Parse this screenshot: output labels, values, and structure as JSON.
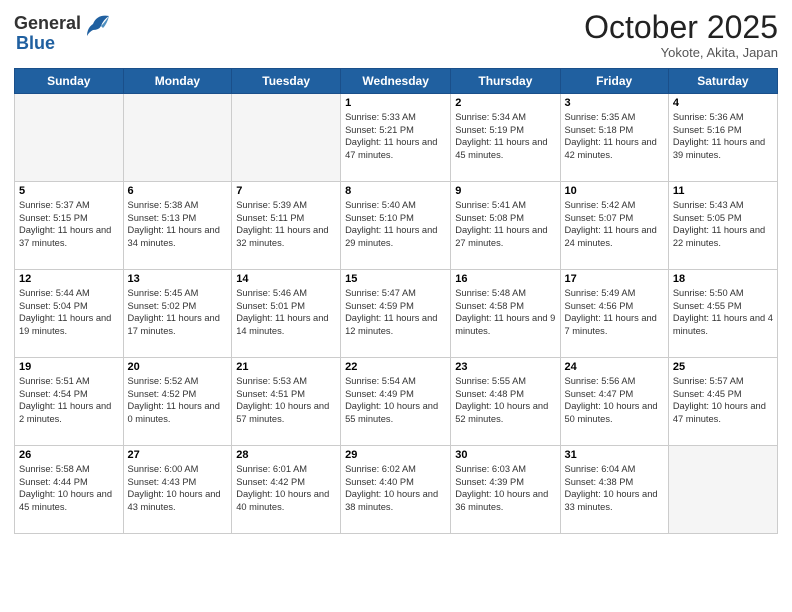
{
  "header": {
    "logo_general": "General",
    "logo_blue": "Blue",
    "month_title": "October 2025",
    "location": "Yokote, Akita, Japan"
  },
  "weekdays": [
    "Sunday",
    "Monday",
    "Tuesday",
    "Wednesday",
    "Thursday",
    "Friday",
    "Saturday"
  ],
  "weeks": [
    [
      {
        "day": "",
        "empty": true
      },
      {
        "day": "",
        "empty": true
      },
      {
        "day": "",
        "empty": true
      },
      {
        "day": "1",
        "sunrise": "5:33 AM",
        "sunset": "5:21 PM",
        "daylight": "11 hours and 47 minutes."
      },
      {
        "day": "2",
        "sunrise": "5:34 AM",
        "sunset": "5:19 PM",
        "daylight": "11 hours and 45 minutes."
      },
      {
        "day": "3",
        "sunrise": "5:35 AM",
        "sunset": "5:18 PM",
        "daylight": "11 hours and 42 minutes."
      },
      {
        "day": "4",
        "sunrise": "5:36 AM",
        "sunset": "5:16 PM",
        "daylight": "11 hours and 39 minutes."
      }
    ],
    [
      {
        "day": "5",
        "sunrise": "5:37 AM",
        "sunset": "5:15 PM",
        "daylight": "11 hours and 37 minutes."
      },
      {
        "day": "6",
        "sunrise": "5:38 AM",
        "sunset": "5:13 PM",
        "daylight": "11 hours and 34 minutes."
      },
      {
        "day": "7",
        "sunrise": "5:39 AM",
        "sunset": "5:11 PM",
        "daylight": "11 hours and 32 minutes."
      },
      {
        "day": "8",
        "sunrise": "5:40 AM",
        "sunset": "5:10 PM",
        "daylight": "11 hours and 29 minutes."
      },
      {
        "day": "9",
        "sunrise": "5:41 AM",
        "sunset": "5:08 PM",
        "daylight": "11 hours and 27 minutes."
      },
      {
        "day": "10",
        "sunrise": "5:42 AM",
        "sunset": "5:07 PM",
        "daylight": "11 hours and 24 minutes."
      },
      {
        "day": "11",
        "sunrise": "5:43 AM",
        "sunset": "5:05 PM",
        "daylight": "11 hours and 22 minutes."
      }
    ],
    [
      {
        "day": "12",
        "sunrise": "5:44 AM",
        "sunset": "5:04 PM",
        "daylight": "11 hours and 19 minutes."
      },
      {
        "day": "13",
        "sunrise": "5:45 AM",
        "sunset": "5:02 PM",
        "daylight": "11 hours and 17 minutes."
      },
      {
        "day": "14",
        "sunrise": "5:46 AM",
        "sunset": "5:01 PM",
        "daylight": "11 hours and 14 minutes."
      },
      {
        "day": "15",
        "sunrise": "5:47 AM",
        "sunset": "4:59 PM",
        "daylight": "11 hours and 12 minutes."
      },
      {
        "day": "16",
        "sunrise": "5:48 AM",
        "sunset": "4:58 PM",
        "daylight": "11 hours and 9 minutes."
      },
      {
        "day": "17",
        "sunrise": "5:49 AM",
        "sunset": "4:56 PM",
        "daylight": "11 hours and 7 minutes."
      },
      {
        "day": "18",
        "sunrise": "5:50 AM",
        "sunset": "4:55 PM",
        "daylight": "11 hours and 4 minutes."
      }
    ],
    [
      {
        "day": "19",
        "sunrise": "5:51 AM",
        "sunset": "4:54 PM",
        "daylight": "11 hours and 2 minutes."
      },
      {
        "day": "20",
        "sunrise": "5:52 AM",
        "sunset": "4:52 PM",
        "daylight": "11 hours and 0 minutes."
      },
      {
        "day": "21",
        "sunrise": "5:53 AM",
        "sunset": "4:51 PM",
        "daylight": "10 hours and 57 minutes."
      },
      {
        "day": "22",
        "sunrise": "5:54 AM",
        "sunset": "4:49 PM",
        "daylight": "10 hours and 55 minutes."
      },
      {
        "day": "23",
        "sunrise": "5:55 AM",
        "sunset": "4:48 PM",
        "daylight": "10 hours and 52 minutes."
      },
      {
        "day": "24",
        "sunrise": "5:56 AM",
        "sunset": "4:47 PM",
        "daylight": "10 hours and 50 minutes."
      },
      {
        "day": "25",
        "sunrise": "5:57 AM",
        "sunset": "4:45 PM",
        "daylight": "10 hours and 47 minutes."
      }
    ],
    [
      {
        "day": "26",
        "sunrise": "5:58 AM",
        "sunset": "4:44 PM",
        "daylight": "10 hours and 45 minutes."
      },
      {
        "day": "27",
        "sunrise": "6:00 AM",
        "sunset": "4:43 PM",
        "daylight": "10 hours and 43 minutes."
      },
      {
        "day": "28",
        "sunrise": "6:01 AM",
        "sunset": "4:42 PM",
        "daylight": "10 hours and 40 minutes."
      },
      {
        "day": "29",
        "sunrise": "6:02 AM",
        "sunset": "4:40 PM",
        "daylight": "10 hours and 38 minutes."
      },
      {
        "day": "30",
        "sunrise": "6:03 AM",
        "sunset": "4:39 PM",
        "daylight": "10 hours and 36 minutes."
      },
      {
        "day": "31",
        "sunrise": "6:04 AM",
        "sunset": "4:38 PM",
        "daylight": "10 hours and 33 minutes."
      },
      {
        "day": "",
        "empty": true
      }
    ]
  ]
}
